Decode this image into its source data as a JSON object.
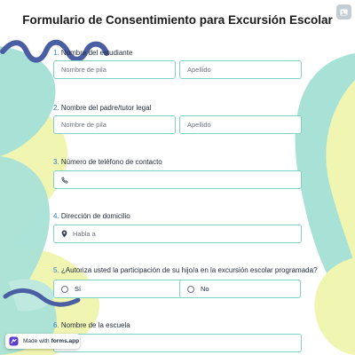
{
  "form": {
    "title": "Formulario de Consentimiento para Excursión Escolar"
  },
  "questions": [
    {
      "number": "1.",
      "label": "Nombre del estudiante",
      "first_name_placeholder": "Nombre de pila",
      "last_name_placeholder": "Apellido"
    },
    {
      "number": "2.",
      "label": "Nombre del padre/tutor legal",
      "first_name_placeholder": "Nombre de pila",
      "last_name_placeholder": "Apellido"
    },
    {
      "number": "3.",
      "label": "Número de teléfono de contacto",
      "icon": "phone-icon",
      "value": ""
    },
    {
      "number": "4.",
      "label": "Dirección de domicilio",
      "icon": "location-pin-icon",
      "placeholder": "Habla a"
    },
    {
      "number": "5.",
      "label": "¿Autoriza usted la participación de su hijo/a en la excursión escolar programada?",
      "options": [
        "Sí",
        "No"
      ]
    },
    {
      "number": "6.",
      "label": "Nombre de la escuela",
      "value": ""
    }
  ],
  "badge": {
    "prefix": "Made with",
    "brand": "forms.app",
    "icon": "forms-app-logo-icon"
  },
  "colors": {
    "teal": "#a8e2d6",
    "yellow": "#f0f5b2",
    "navy": "#4a5ea3",
    "field_border": "#7fd3c2",
    "number": "#2f7fc1"
  },
  "corner_icon": "image-icon"
}
